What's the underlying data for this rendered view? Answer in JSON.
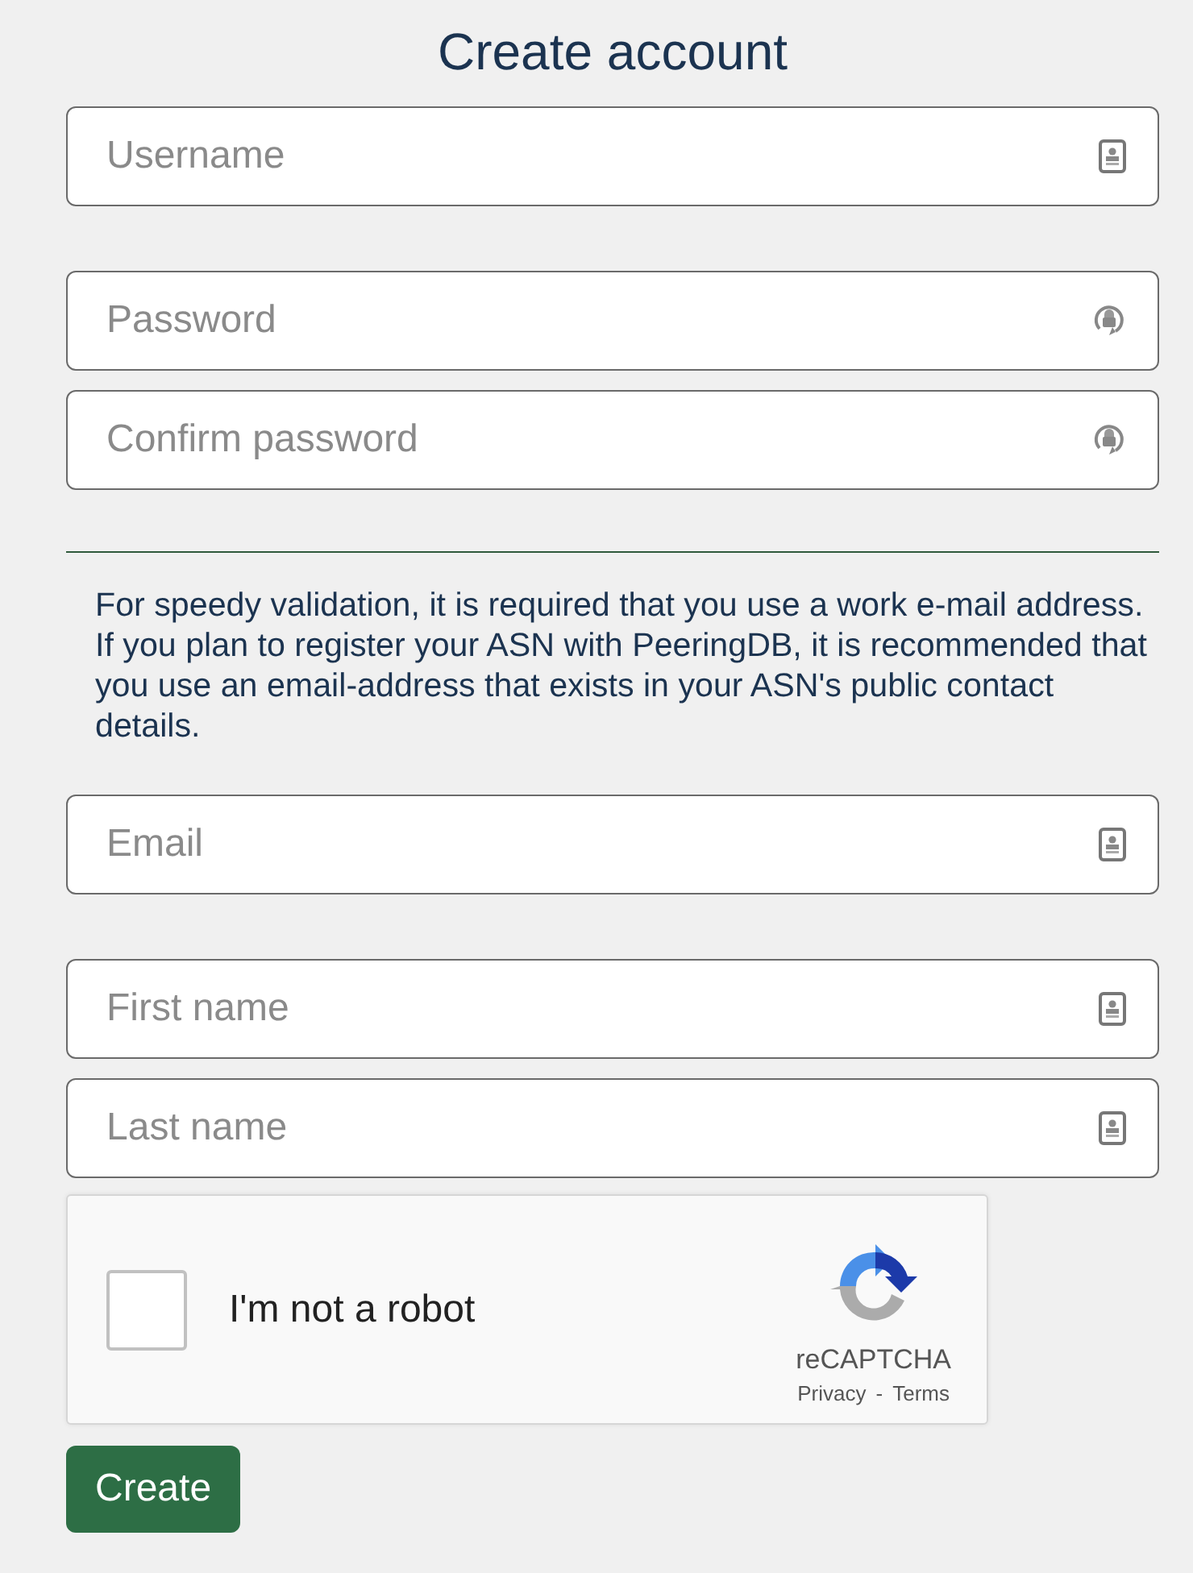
{
  "title": "Create account",
  "sections": [
    {
      "kind": "fields",
      "fields": [
        {
          "placeholder": "Username",
          "kind": "contact"
        }
      ]
    },
    {
      "kind": "fields",
      "fields": [
        {
          "placeholder": "Password",
          "kind": "password"
        },
        {
          "placeholder": "Confirm password",
          "kind": "password"
        }
      ]
    },
    {
      "kind": "notice",
      "text": "For speedy validation, it is required that you use a work e-mail address. If you plan to register your ASN with PeeringDB, it is recommended that you use an email-address that exists in your ASN's public contact details."
    },
    {
      "kind": "fields",
      "fields": [
        {
          "placeholder": "Email",
          "kind": "contact"
        }
      ]
    },
    {
      "kind": "fields",
      "fields": [
        {
          "placeholder": "First name",
          "kind": "contact"
        },
        {
          "placeholder": "Last name",
          "kind": "contact"
        }
      ]
    }
  ],
  "captcha": {
    "checked": false,
    "label": "I'm not a robot",
    "brand": "reCAPTCHA",
    "privacy": "Privacy",
    "separator": "-",
    "terms": "Terms"
  },
  "submit": "Create"
}
